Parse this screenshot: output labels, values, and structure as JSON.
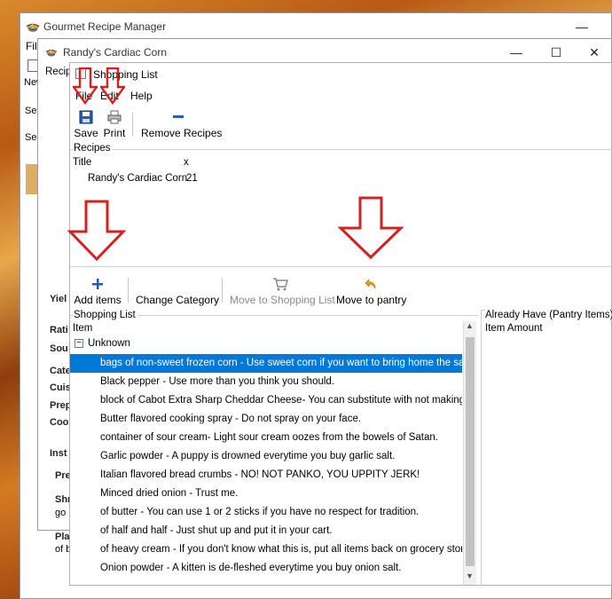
{
  "main_window": {
    "title": "Gourmet Recipe Manager",
    "menu_file": "File",
    "tab_recipe": "Recipe",
    "new_label": "New",
    "search_1": "Sea",
    "search_2": "Sea"
  },
  "left_labels": {
    "yield": "Yiel",
    "rating": "Rati",
    "source": "Sou",
    "category": "Cate",
    "cuisine": "Cuis",
    "prep": "Prep",
    "cook": "Cool",
    "instructions": "Inst",
    "pre": "Pre",
    "shr": "Shr",
    "go": "go",
    "pla": "Pla",
    "of": "of b"
  },
  "recipe_window": {
    "title": "Randy's Cardiac Corn",
    "minimize": "—",
    "maximize": "☐",
    "close": "✕"
  },
  "shopping_window": {
    "title": "Shopping List",
    "menu": [
      "File",
      "Edit",
      "Help"
    ],
    "toolbar": {
      "save": "Save",
      "print": "Print",
      "remove_recipes": "Remove Recipes"
    },
    "recipes_group": "Recipes",
    "recipes_columns": {
      "title": "Title",
      "x": "x"
    },
    "recipes_rows": [
      {
        "title": "Randy's Cardiac Corn",
        "x": "21"
      }
    ],
    "action_toolbar": {
      "add_items": "Add items",
      "change_category": "Change Category",
      "move_to_shopping": "Move to Shopping List",
      "move_to_pantry": "Move to pantry"
    },
    "shopping_group": "Shopping List",
    "shopping_column": "Item",
    "category": "Unknown",
    "items": [
      "bags of non-sweet frozen corn - Use sweet corn if you want to bring home the same",
      "Black pepper - Use more than you think you should.",
      "block of Cabot Extra Sharp Cheddar Cheese- You can substitute with not making thi",
      "Butter flavored cooking spray - Do not spray on your face.",
      "container of sour cream- Light sour cream oozes from the bowels of Satan.",
      "Garlic powder - A puppy is drowned everytime you buy garlic salt.",
      "Italian flavored bread crumbs - NO! NOT PANKO, YOU UPPITY JERK!",
      "Minced dried onion - Trust me.",
      "of butter - You can use 1 or 2 sticks if you have no respect for tradition.",
      "of half and half - Just shut up and put it in your cart.",
      "of heavy cream - If you don't know what this is, put all items back on grocery store s",
      "Onion powder - A kitten is de-fleshed everytime you buy onion salt."
    ],
    "pantry_group": "Already Have (Pantry Items)",
    "pantry_columns": "Item Amount"
  },
  "colors": {
    "selection": "#0078d7",
    "arrow": "#d42020",
    "add_icon": "#1e5bb8",
    "pantry_icon": "#e0a020"
  }
}
